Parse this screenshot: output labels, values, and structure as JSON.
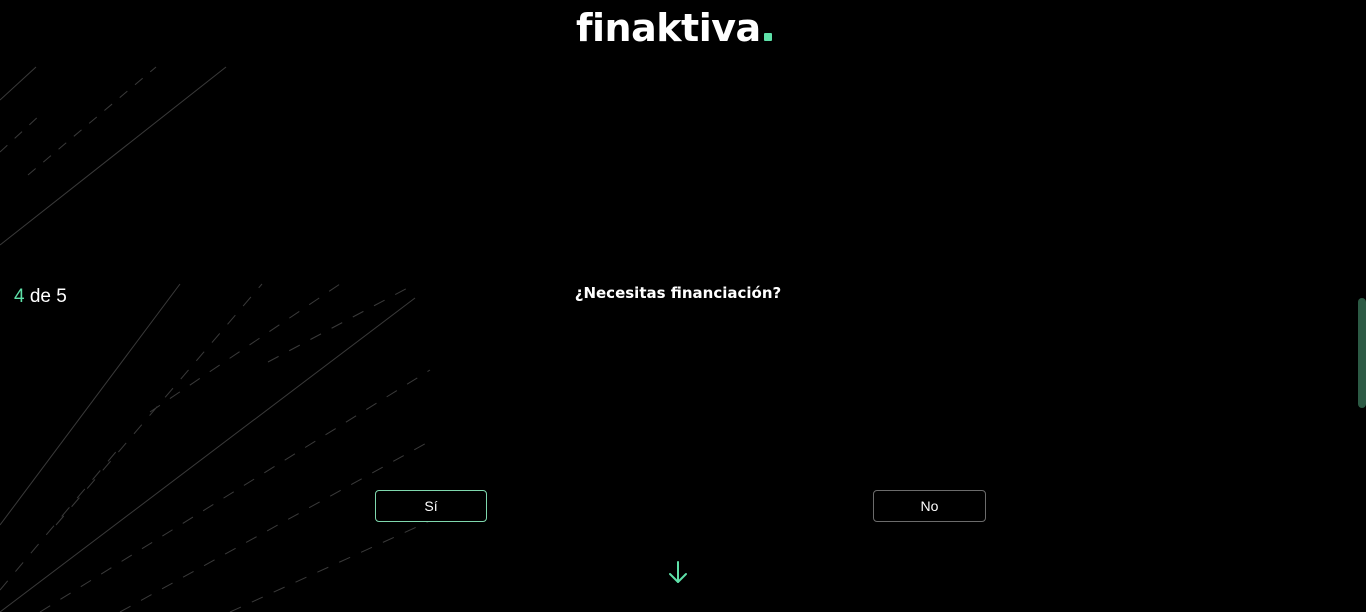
{
  "brand": {
    "logo_text": "finaktiva",
    "accent_color": "#5ee0a8"
  },
  "progress": {
    "current": "4",
    "separator_text": "de 5"
  },
  "question": {
    "text": "¿Necesitas financiación?"
  },
  "answers": {
    "yes_label": "Sí",
    "no_label": "No"
  },
  "icons": {
    "next": "arrow-down-icon",
    "background": "diagonal-lines-decoration"
  }
}
